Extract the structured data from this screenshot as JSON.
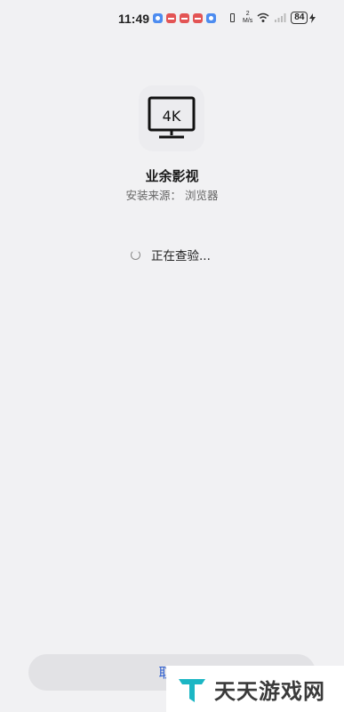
{
  "status_bar": {
    "time": "11:49",
    "net_speed_value": "2",
    "net_speed_unit": "M/s",
    "battery": "84"
  },
  "app": {
    "icon_label": "4K",
    "name": "业余影视",
    "install_source_label": "安装来源：",
    "install_source_value": "浏览器"
  },
  "status": {
    "checking_text": "正在查验..."
  },
  "actions": {
    "cancel_label": "取消"
  },
  "watermark": {
    "text": "天天游戏网"
  },
  "colors": {
    "background": "#f1f1f3",
    "accent": "#2f5fd0",
    "watermark_teal": "#1bb6c4"
  }
}
